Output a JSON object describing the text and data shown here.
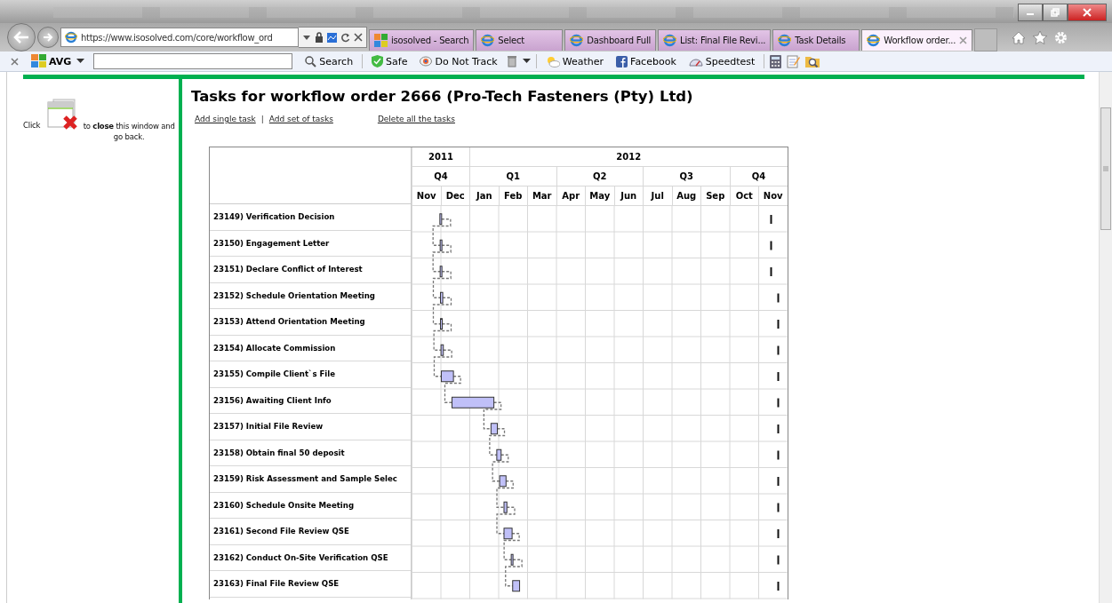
{
  "browser": {
    "address": "https://www.isosolved.com/core/workflow_ord",
    "tabs": [
      {
        "label": "isosolved - Search",
        "selected": false,
        "kind": "avg"
      },
      {
        "label": "Select",
        "selected": false,
        "kind": "ie"
      },
      {
        "label": "Dashboard Full",
        "selected": false,
        "kind": "ie"
      },
      {
        "label": "List: Final File Revi...",
        "selected": false,
        "kind": "ie"
      },
      {
        "label": "Task Details",
        "selected": false,
        "kind": "ie"
      },
      {
        "label": "Workflow order...",
        "selected": true,
        "kind": "ie"
      }
    ],
    "toolbar": {
      "brand": "AVG",
      "search_button": "Search",
      "items": [
        {
          "label": "Safe",
          "kind": "shield"
        },
        {
          "label": "Do Not Track",
          "kind": "eye"
        },
        {
          "label": "Weather",
          "kind": "weather"
        },
        {
          "label": "Facebook",
          "kind": "facebook"
        },
        {
          "label": "Speedtest",
          "kind": "gauge"
        }
      ]
    }
  },
  "sidebar": {
    "before": "Click",
    "after": "to **close** this window and go back."
  },
  "page": {
    "title": "Tasks for workflow order 2666 (Pro-Tech Fasteners (Pty) Ltd)",
    "links": [
      "Add single task",
      "Add set of tasks",
      "Delete all the tasks"
    ],
    "separator": "|"
  },
  "gantt": {
    "kind": "picture",
    "years": [
      {
        "label": "2011",
        "quarters": [
          {
            "label": "Q4",
            "months": [
              "Nov",
              "Dec"
            ]
          }
        ]
      },
      {
        "label": "2012",
        "quarters": [
          {
            "label": "Q1",
            "months": [
              "Jan",
              "Feb",
              "Mar"
            ]
          },
          {
            "label": "Q2",
            "months": [
              "Apr",
              "May",
              "Jun"
            ]
          },
          {
            "label": "Q3",
            "months": [
              "Jul",
              "Aug",
              "Sep"
            ]
          },
          {
            "label": "Q4",
            "months": [
              "Oct",
              "Nov"
            ]
          }
        ]
      }
    ],
    "tasks": [
      "23149) Verification Decision",
      "23150) Engagement Letter",
      "23151) Declare Conflict of Interest",
      "23152) Schedule Orientation Meeting",
      "23153) Attend Orientation Meeting",
      "23154) Allocate Commission",
      "23155) Compile Client`s File",
      "23156) Awaiting Client Info",
      "23157) Initial File Review",
      "23158) Obtain final 50 deposit",
      "23159) Risk Assessment and Sample Selec",
      "23160) Schedule Onsite Meeting",
      "23161) Second File Review QSE",
      "23162) Conduct On-Site Verification QSE",
      "23163) Final File Review QSE"
    ]
  }
}
